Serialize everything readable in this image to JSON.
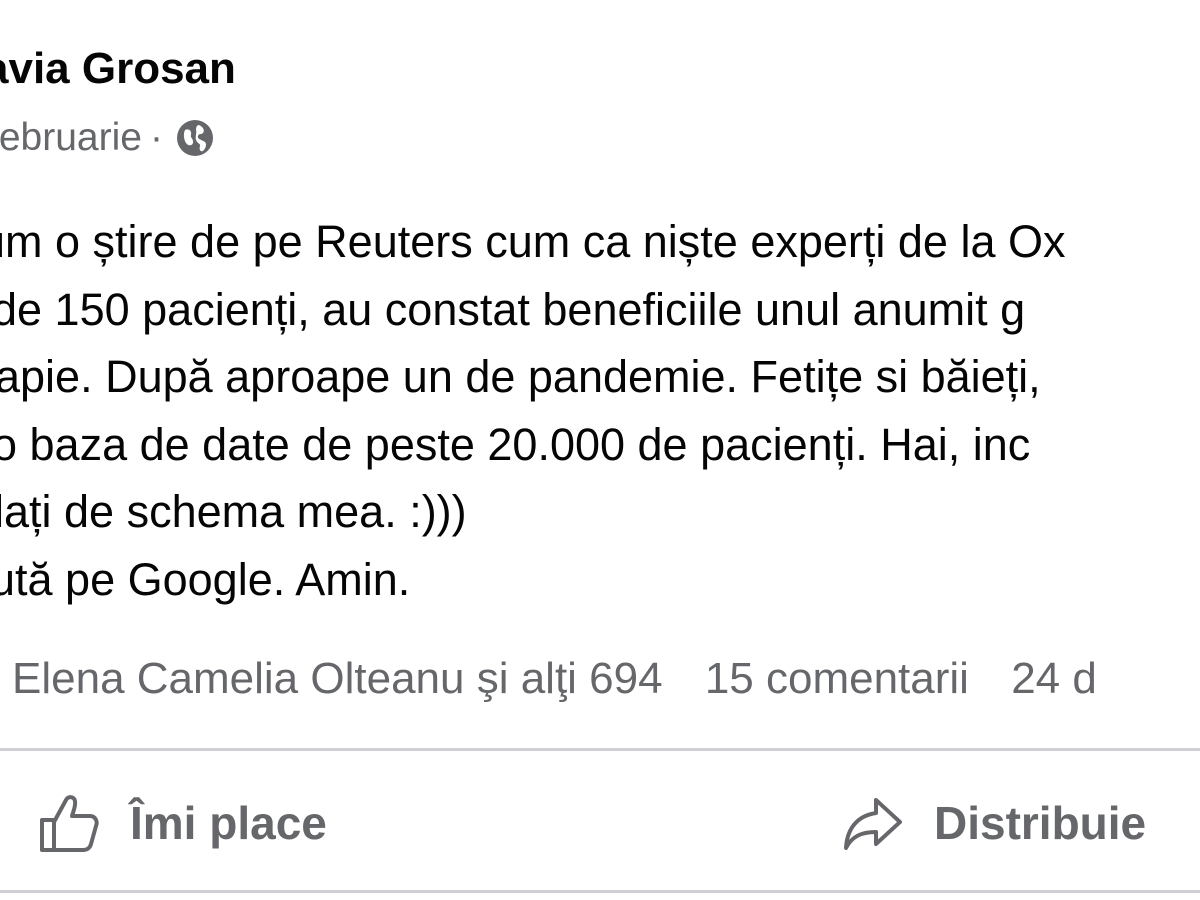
{
  "post": {
    "author": "avia Grosan",
    "date": "februarie",
    "separator": "·",
    "privacy_icon": "globe-icon",
    "lines": [
      "um o știre de pe Reuters cum ca niște experți de la Ox",
      "de 150 pacienți, au constat beneficiile unul anumit g",
      "rapie. După aproape un de pandemie. Fetițe si băieți,",
      "o baza de date de peste 20.000 de pacienți. Hai, inc",
      "lați de schema mea. :)))",
      "ută pe Google. Amin."
    ],
    "reactions_text": "Elena Camelia Olteanu şi alţi 694",
    "comments_text": "15 comentarii",
    "shares_text": "24 d"
  },
  "actions": {
    "like_label": "Îmi place",
    "like_icon": "thumbs-up-icon",
    "share_label": "Distribuie",
    "share_icon": "share-arrow-icon"
  },
  "colors": {
    "text": "#050505",
    "secondary": "#65676b",
    "divider": "#ced0d4"
  }
}
